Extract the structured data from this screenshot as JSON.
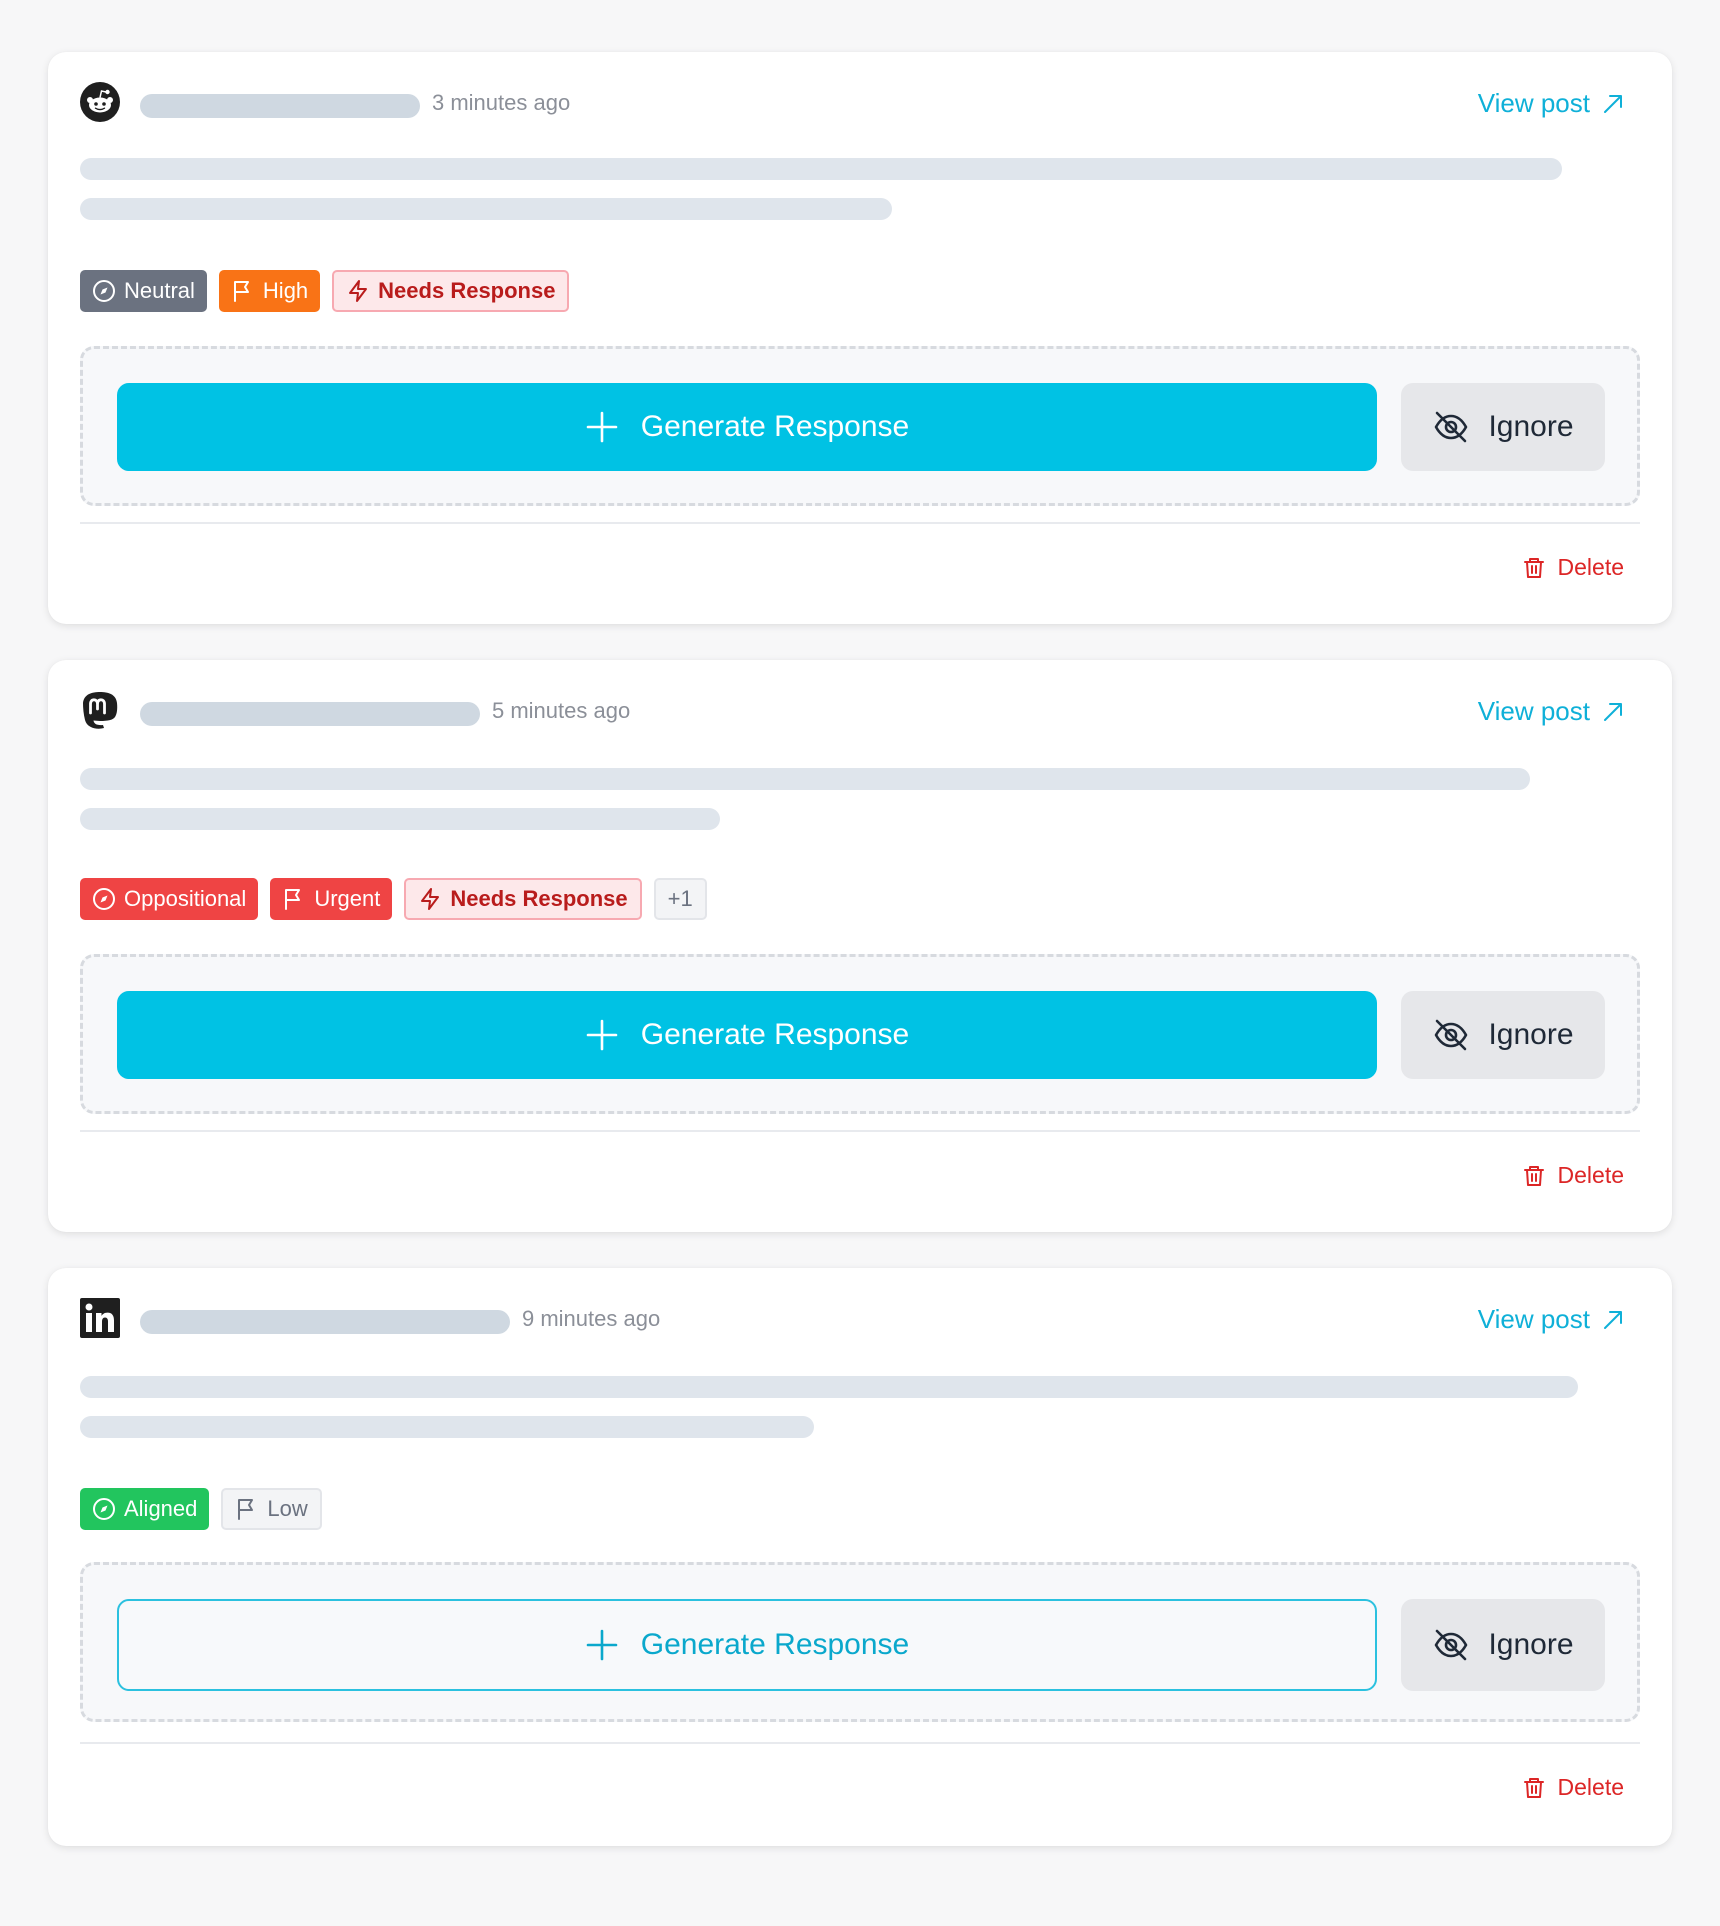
{
  "posts": [
    {
      "platform_icon": "reddit-icon",
      "timestamp": "3 minutes ago",
      "view_post": "View post",
      "tags": {
        "stance": "Neutral",
        "priority": "High",
        "status": "Needs Response"
      },
      "generate_label": "Generate Response",
      "ignore_label": "Ignore",
      "delete_label": "Delete"
    },
    {
      "platform_icon": "mastodon-icon",
      "timestamp": "5 minutes ago",
      "view_post": "View post",
      "tags": {
        "stance": "Oppositional",
        "priority": "Urgent",
        "status": "Needs Response",
        "more": "+1"
      },
      "generate_label": "Generate Response",
      "ignore_label": "Ignore",
      "delete_label": "Delete"
    },
    {
      "platform_icon": "linkedin-icon",
      "timestamp": "9 minutes ago",
      "view_post": "View post",
      "tags": {
        "stance": "Aligned",
        "priority": "Low"
      },
      "generate_label": "Generate Response",
      "ignore_label": "Ignore",
      "delete_label": "Delete"
    }
  ],
  "colors": {
    "accent": "#00c2e4",
    "link": "#0fb0d8",
    "danger": "#dc2626",
    "neutral": "#6b7280",
    "high": "#f97316",
    "urgent": "#ef4444",
    "aligned": "#22c55e"
  }
}
